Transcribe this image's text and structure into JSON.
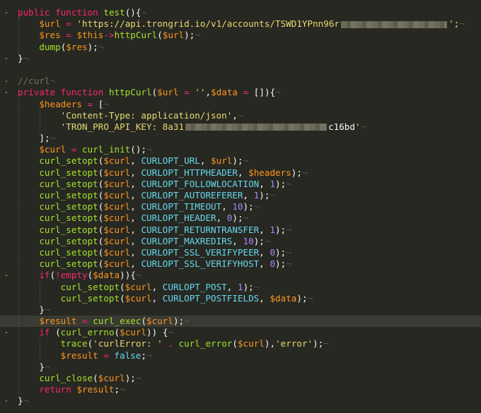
{
  "editor": {
    "lines": [
      {
        "text": "public function test(){",
        "fold": true
      },
      {
        "text": "    $url = 'https://api.trongrid.io/v1/accounts/TSWD1YPnn96r",
        "redacted_after": true,
        "tail": "';"
      },
      {
        "text": "    $res = $this->httpCurl($url);"
      },
      {
        "text": "    dump($res);"
      },
      {
        "text": "}",
        "fold": true
      },
      {
        "text": ""
      },
      {
        "text": "//curl",
        "fold": true
      },
      {
        "text": "private function httpCurl($url = '',$data = []){",
        "fold": true
      },
      {
        "text": "    $headers = ["
      },
      {
        "text": "        'Content-Type: application/json',"
      },
      {
        "text": "        'TRON_PRO_API_KEY: 8a31",
        "redacted_after": true,
        "tail": "c16bd'"
      },
      {
        "text": "    ];"
      },
      {
        "text": "    $curl = curl_init();"
      },
      {
        "text": "    curl_setopt($curl, CURLOPT_URL, $url);"
      },
      {
        "text": "    curl_setopt($curl, CURLOPT_HTTPHEADER, $headers);"
      },
      {
        "text": "    curl_setopt($curl, CURLOPT_FOLLOWLOCATION, 1);"
      },
      {
        "text": "    curl_setopt($curl, CURLOPT_AUTOREFERER, 1);"
      },
      {
        "text": "    curl_setopt($curl, CURLOPT_TIMEOUT, 10);"
      },
      {
        "text": "    curl_setopt($curl, CURLOPT_HEADER, 0);"
      },
      {
        "text": "    curl_setopt($curl, CURLOPT_RETURNTRANSFER, 1);"
      },
      {
        "text": "    curl_setopt($curl, CURLOPT_MAXREDIRS, 10);"
      },
      {
        "text": "    curl_setopt($curl, CURLOPT_SSL_VERIFYPEER, 0);"
      },
      {
        "text": "    curl_setopt($curl, CURLOPT_SSL_VERIFYHOST, 0);"
      },
      {
        "text": "    if(!empty($data)){",
        "fold": true
      },
      {
        "text": "        curl_setopt($curl, CURLOPT_POST, 1);"
      },
      {
        "text": "        curl_setopt($curl, CURLOPT_POSTFIELDS, $data);"
      },
      {
        "text": "    }"
      },
      {
        "text": "    $result = curl_exec($curl);",
        "current": true
      },
      {
        "text": "    if (curl_errno($curl)) {",
        "fold": true
      },
      {
        "text": "        trace('curlError: ' . curl_error($curl),'error');"
      },
      {
        "text": "        $result = false;"
      },
      {
        "text": "    }"
      },
      {
        "text": "    curl_close($curl);"
      },
      {
        "text": "    return $result;"
      },
      {
        "text": "}",
        "fold": true
      }
    ]
  }
}
